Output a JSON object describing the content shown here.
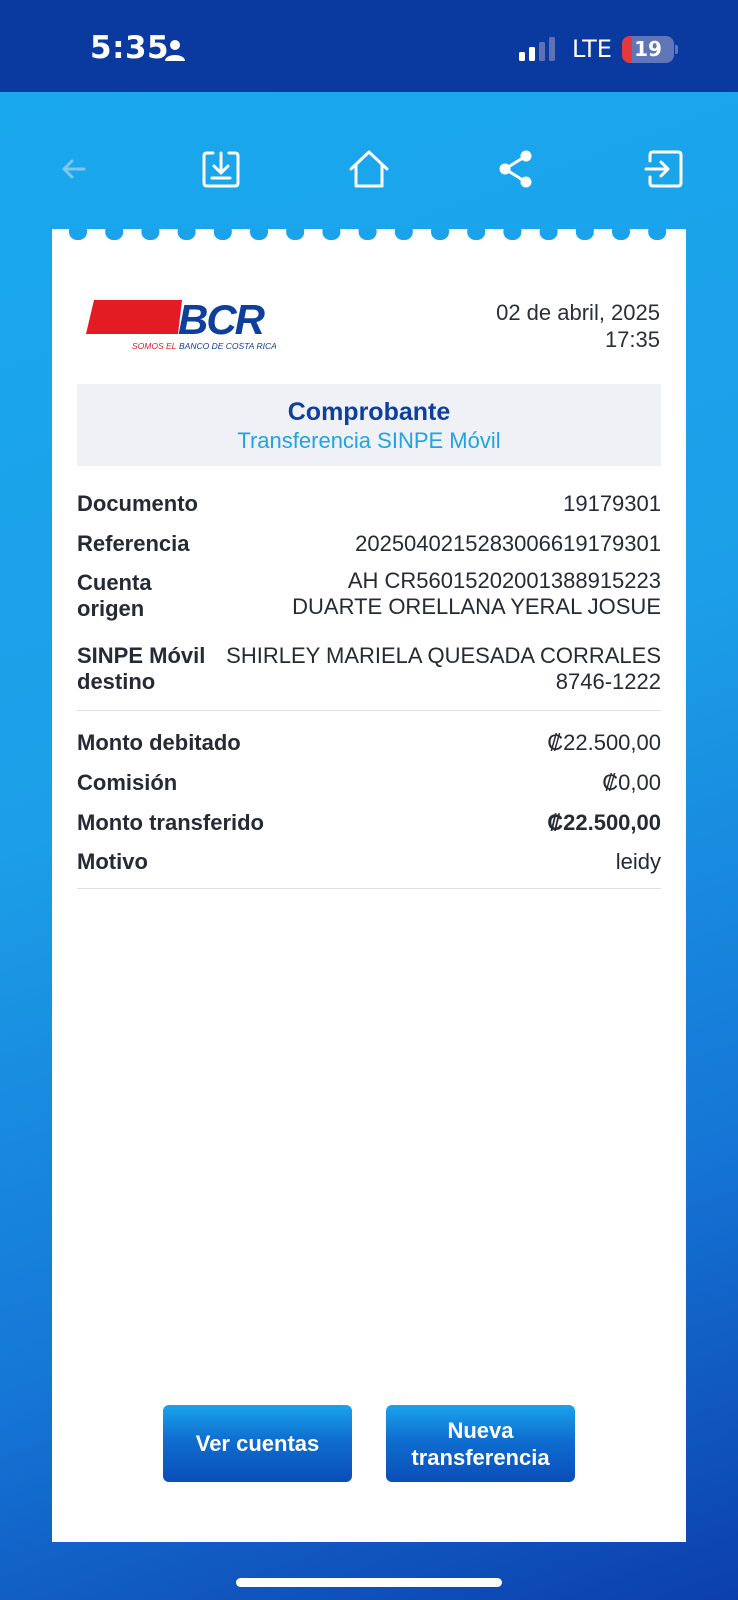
{
  "status_bar": {
    "time": "5:35",
    "network": "LTE",
    "battery_level": "19",
    "battery_fraction": 0.19
  },
  "toolbar": {
    "icons": [
      "back-arrow-icon",
      "download-icon",
      "home-icon",
      "share-icon",
      "exit-icon"
    ]
  },
  "receipt": {
    "logo": {
      "brand": "BCR",
      "tagline": "SOMOS EL BANCO DE COSTA RICA",
      "tagline_prefix": "SOMOS EL",
      "tagline_rest": "BANCO DE COSTA RICA"
    },
    "date": "02 de abril, 2025",
    "time": "17:35",
    "title": "Comprobante",
    "subtitle": "Transferencia SINPE Móvil",
    "details": {
      "documento_label": "Documento",
      "documento_value": "19179301",
      "referencia_label": "Referencia",
      "referencia_value": "2025040215283006619179301",
      "cuenta_label_1": "Cuenta",
      "cuenta_label_2": "origen",
      "cuenta_value_1": "AH CR56015202001388915223",
      "cuenta_value_2": "DUARTE ORELLANA YERAL JOSUE",
      "sinpe_label_1": "SINPE Móvil",
      "sinpe_label_2": "destino",
      "sinpe_value_1": "SHIRLEY MARIELA QUESADA CORRALES",
      "sinpe_value_2": "8746-1222"
    },
    "amounts": {
      "monto_debitado_label": "Monto debitado",
      "monto_debitado_value": "₡22.500,00",
      "comision_label": "Comisión",
      "comision_value": "₡0,00",
      "monto_transferido_label": "Monto transferido",
      "monto_transferido_value": "₡22.500,00",
      "motivo_label": "Motivo",
      "motivo_value": "leidy"
    },
    "buttons": {
      "ver_cuentas": "Ver cuentas",
      "nueva_transferencia": "Nueva\ntransferencia"
    }
  },
  "colors": {
    "status_bar_bg": "#0a3aa0",
    "background_blue": "#1aa3ea",
    "bcr_red": "#e31b23",
    "bcr_blue": "#0e3f9c",
    "subtitle_cyan": "#21a3df"
  }
}
